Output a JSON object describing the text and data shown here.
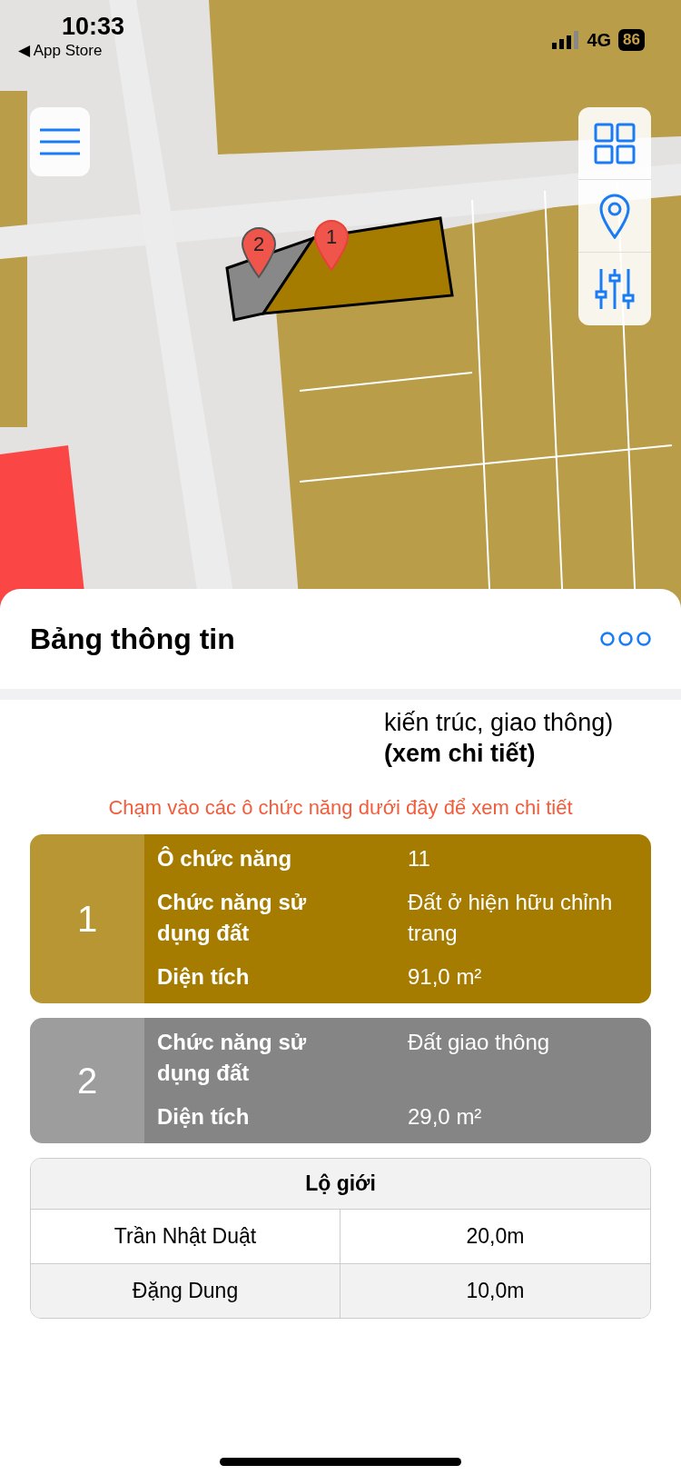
{
  "status_bar": {
    "time": "10:33",
    "back_label": "◀ App Store",
    "network": "4G",
    "battery": "86"
  },
  "map": {
    "markers": [
      {
        "label": "2",
        "color": "#555555"
      },
      {
        "label": "1",
        "color": "#e8403a"
      }
    ]
  },
  "map_controls": [
    {
      "kind": "layers"
    },
    {
      "kind": "location"
    },
    {
      "kind": "filters"
    }
  ],
  "panel": {
    "title": "Bảng thông tin",
    "description_tail": "kiến trúc, giao thông)",
    "detail_link": "(xem chi tiết)",
    "hint": "Chạm vào các ô chức năng dưới đây để xem chi tiết",
    "zones": [
      {
        "number": "1",
        "color": "#a67c00",
        "rows": [
          {
            "label": "Ô chức năng",
            "value": "11"
          },
          {
            "label": "Chức năng sử dụng đất",
            "value": "Đất ở hiện hữu chỉnh trang"
          },
          {
            "label": "Diện tích",
            "value": "91,0 m²"
          }
        ]
      },
      {
        "number": "2",
        "color": "#858585",
        "rows": [
          {
            "label": "Chức năng sử dụng đất",
            "value": "Đất giao thông"
          },
          {
            "label": "Diện tích",
            "value": "29,0 m²"
          }
        ]
      }
    ],
    "road_width": {
      "title": "Lộ giới",
      "rows": [
        {
          "road": "Trần Nhật Duật",
          "width": "20,0m"
        },
        {
          "road": "Đặng Dung",
          "width": "10,0m"
        }
      ]
    }
  }
}
